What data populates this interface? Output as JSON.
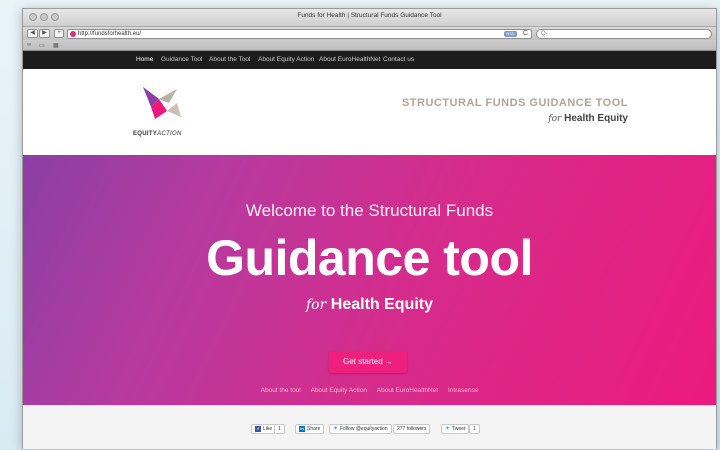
{
  "window": {
    "title": "Funds for Health | Structural Funds Guidance Tool"
  },
  "toolbar": {
    "back": "◀",
    "forward": "▶",
    "add": "+",
    "url": "http://fundsforhealth.eu/",
    "rss": "RSS",
    "reload": "C",
    "search_placeholder": "Q-"
  },
  "sitenav": {
    "items": [
      "Home",
      "Guidance Tool",
      "About the Tool",
      "About Equity Action",
      "About EuroHealthNet",
      "Contact us"
    ]
  },
  "header": {
    "logo_bold": "EQUITY",
    "logo_light": "ACTION",
    "title": "STRUCTURAL FUNDS GUIDANCE TOOL",
    "sub_for": "for",
    "sub_bold": "Health Equity"
  },
  "hero": {
    "welcome": "Welcome to the Structural Funds",
    "main": "Guidance tool",
    "sub_for": "for",
    "sub_bold": "Health Equity",
    "cta": "Get started →",
    "links": [
      "About the tool",
      "About Equity Action",
      "About EuroHealthNet",
      "Intrasense"
    ]
  },
  "social": {
    "like": "Like",
    "like_count": "1",
    "share": "Share",
    "follow": "Follow @equityaction",
    "followers": "277 followers",
    "tweet": "Tweet",
    "tweet_count": "1"
  },
  "colors": {
    "hero_start": "#8a3fa4",
    "hero_end": "#ec1a7d",
    "cta": "#ee1f7d",
    "nav_bg": "#1c1c1c",
    "title_color": "#b0a49a"
  }
}
